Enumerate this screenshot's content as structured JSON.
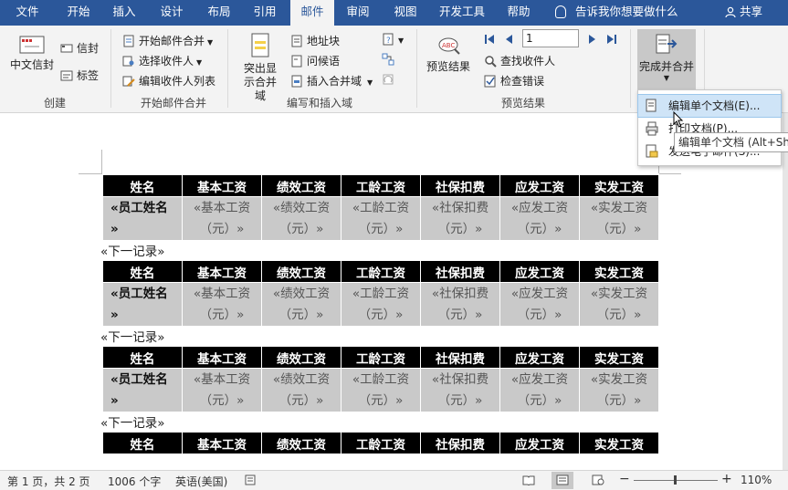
{
  "tabs": [
    "文件",
    "开始",
    "插入",
    "设计",
    "布局",
    "引用",
    "邮件",
    "审阅",
    "视图",
    "开发工具",
    "帮助"
  ],
  "active_tab": "邮件",
  "tell_me": "告诉我你想要做什么",
  "share": "共享",
  "ribbon": {
    "create": {
      "label": "创建",
      "envelopes": "中文信封",
      "envelope_small": "信封",
      "labels": "标签"
    },
    "start_merge": {
      "label": "开始邮件合并",
      "start": "开始邮件合并",
      "select_recipients": "选择收件人",
      "edit_list": "编辑收件人列表"
    },
    "write_insert": {
      "label": "编写和插入域",
      "highlight": "突出显示合并域",
      "address_block": "地址块",
      "greeting": "问候语",
      "insert_field": "插入合并域"
    },
    "preview": {
      "label": "预览结果",
      "preview_results": "预览结果",
      "record": "1",
      "find_recipient": "查找收件人",
      "check_errors": "检查错误"
    },
    "finish": {
      "finish_merge": "完成并合并"
    }
  },
  "dropdown": {
    "items": [
      "编辑单个文档(E)...",
      "打印文档(P)...",
      "发送电子邮件(S)..."
    ],
    "tooltip": "编辑单个文档 (Alt+Shi"
  },
  "table": {
    "headers": [
      "姓名",
      "基本工资",
      "绩效工资",
      "工龄工资",
      "社保扣费",
      "应发工资",
      "实发工资"
    ],
    "fields_line1": [
      "«员工姓名",
      "«基本工资",
      "«绩效工资",
      "«工龄工资",
      "«社保扣费",
      "«应发工资",
      "«实发工资"
    ],
    "fields_line2": [
      "»",
      "（元）»",
      "（元）»",
      "（元）»",
      "（元）»",
      "（元）»",
      "（元）»"
    ]
  },
  "next_record": "«下一记录»",
  "status": {
    "page": "第 1 页，共 2 页",
    "words": "1006 个字",
    "language": "英语(美国)",
    "zoom": "110%"
  }
}
